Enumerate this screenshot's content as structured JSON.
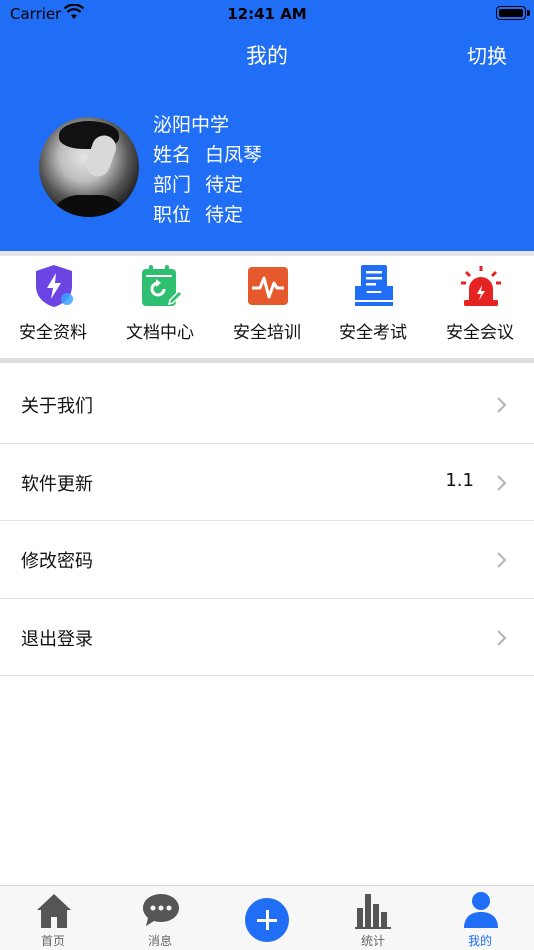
{
  "status_bar": {
    "carrier": "Carrier",
    "time": "12:41 AM"
  },
  "nav": {
    "title": "我的",
    "switch_label": "切换"
  },
  "profile": {
    "school": "泌阳中学",
    "name_label": "姓名",
    "name_value": "白凤琴",
    "dept_label": "部门",
    "dept_value": "待定",
    "position_label": "职位",
    "position_value": "待定"
  },
  "quick_menu": [
    {
      "label": "安全资料",
      "icon": "shield-bolt-icon",
      "color": "#6a45e3"
    },
    {
      "label": "文档中心",
      "icon": "calendar-refresh-icon",
      "color": "#2fbf71"
    },
    {
      "label": "安全培训",
      "icon": "pulse-chart-icon",
      "color": "#e5592c"
    },
    {
      "label": "安全考试",
      "icon": "document-tray-icon",
      "color": "#1f6ef5"
    },
    {
      "label": "安全会议",
      "icon": "alarm-siren-icon",
      "color": "#e62323"
    }
  ],
  "settings_list": [
    {
      "label": "关于我们",
      "value": ""
    },
    {
      "label": "软件更新",
      "value": "1.1"
    },
    {
      "label": "修改密码",
      "value": ""
    },
    {
      "label": "退出登录",
      "value": ""
    }
  ],
  "tab_bar": {
    "home": "首页",
    "messages": "消息",
    "stats": "统计",
    "mine": "我的",
    "active": "我的",
    "accent": "#1f6ef5",
    "inactive_icon_color": "#555555"
  }
}
